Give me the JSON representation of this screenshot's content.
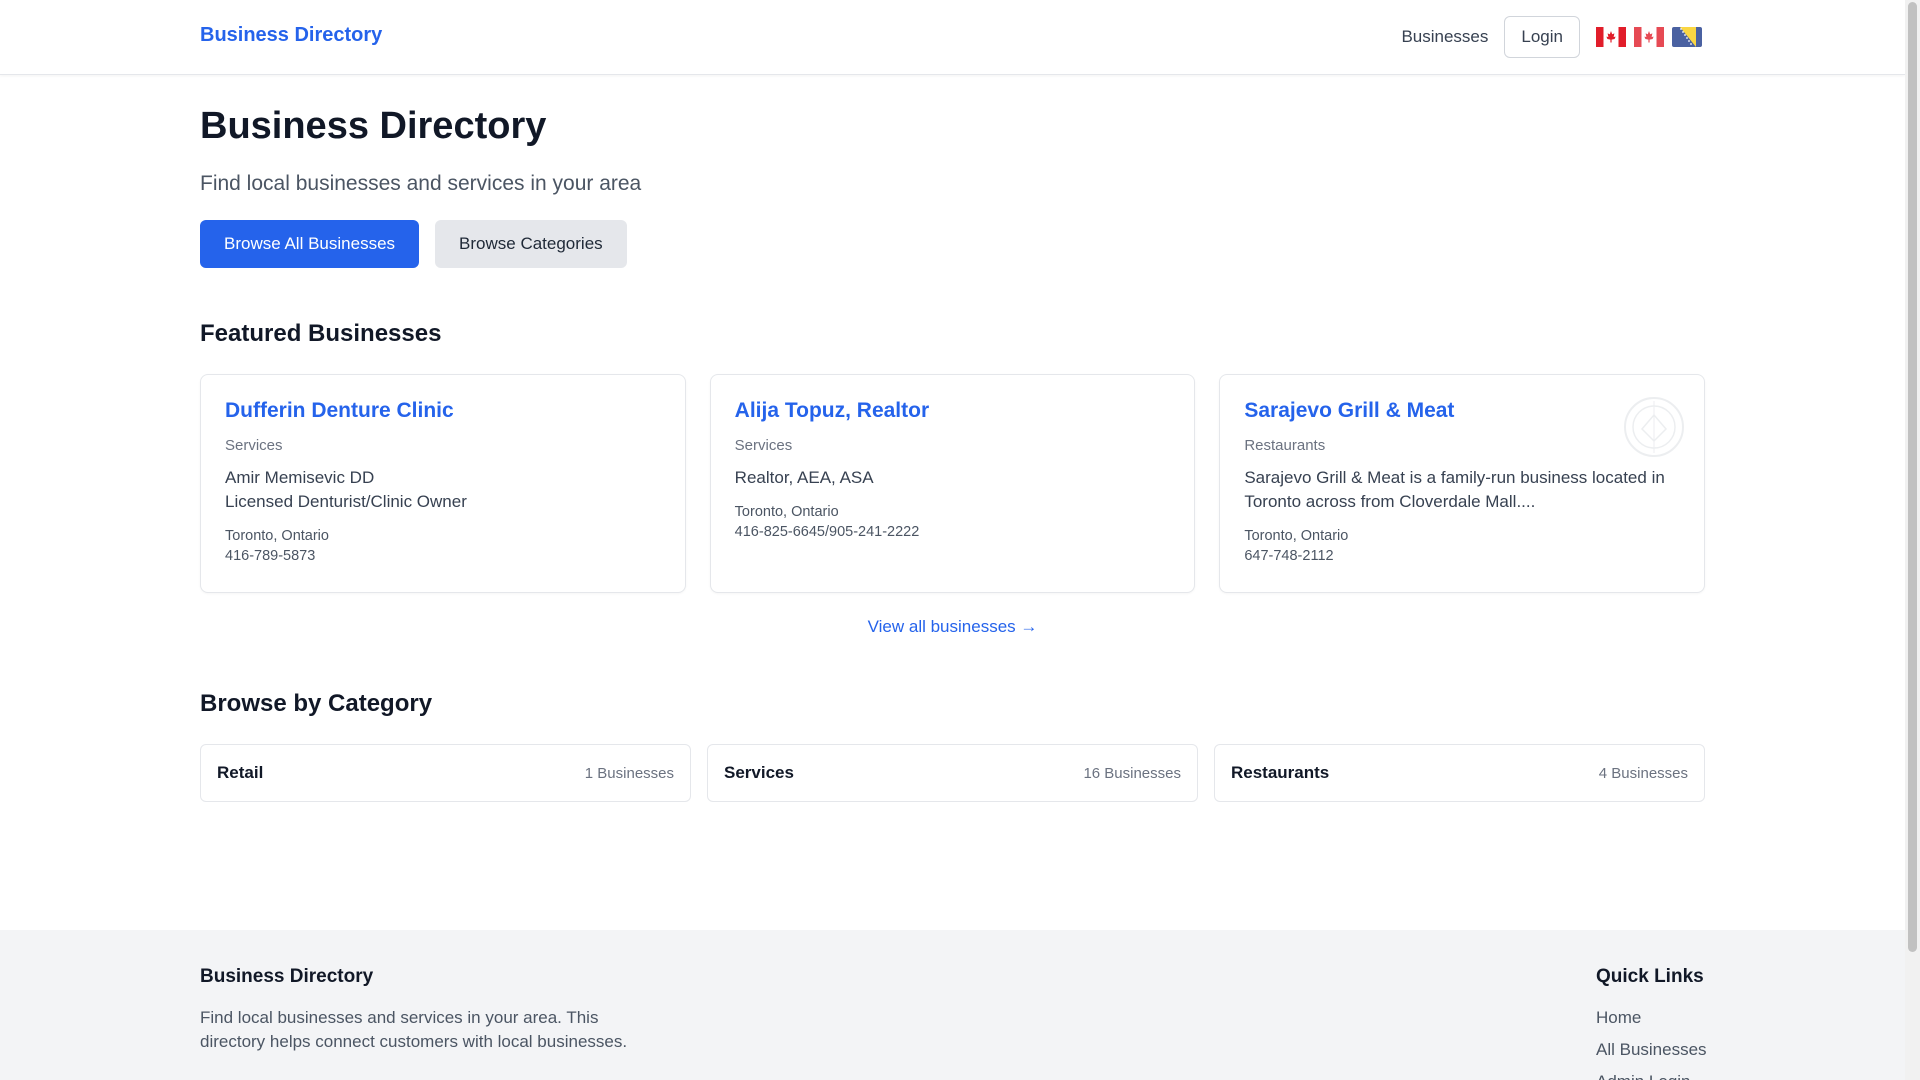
{
  "header": {
    "brand": "Business Directory",
    "nav_businesses": "Businesses",
    "login_label": "Login",
    "flags": [
      "canada-flag-icon",
      "canada-flag-icon",
      "bosnia-flag-icon"
    ]
  },
  "hero": {
    "title": "Business Directory",
    "subtitle": "Find local businesses and services in your area",
    "primary_button": "Browse All Businesses",
    "secondary_button": "Browse Categories"
  },
  "featured": {
    "title": "Featured Businesses",
    "cards": [
      {
        "name": "Dufferin Denture Clinic",
        "category": "Services",
        "desc_line1": "Amir Memisevic DD",
        "desc_line2": "Licensed Denturist/Clinic Owner",
        "location": "Toronto, Ontario",
        "phone": "416-789-5873"
      },
      {
        "name": "Alija Topuz, Realtor",
        "category": "Services",
        "desc_line1": "Realtor, AEA, ASA",
        "location": "Toronto, Ontario",
        "phone": "416-825-6645/905-241-2222"
      },
      {
        "name": "Sarajevo Grill & Meat",
        "category": "Restaurants",
        "desc_line1": "Sarajevo Grill & Meat is a family-run business located in Toronto across from Cloverdale Mall....",
        "location": "Toronto, Ontario",
        "phone": "647-748-2112",
        "logo_icon": "restaurant-logo-icon"
      }
    ],
    "view_all": "View all businesses →"
  },
  "categories": {
    "title": "Browse by Category",
    "items": [
      {
        "name": "Retail",
        "count": "1 Businesses"
      },
      {
        "name": "Services",
        "count": "16 Businesses"
      },
      {
        "name": "Restaurants",
        "count": "4 Businesses"
      }
    ]
  },
  "footer": {
    "brand": "Business Directory",
    "text": "Find local businesses and services in your area. This directory helps connect customers with local businesses.",
    "links_title": "Quick Links",
    "links": [
      "Home",
      "All Businesses",
      "Admin Login"
    ]
  },
  "colors": {
    "accent": "#2563eb",
    "footer_bg": "#f3f4f6"
  }
}
